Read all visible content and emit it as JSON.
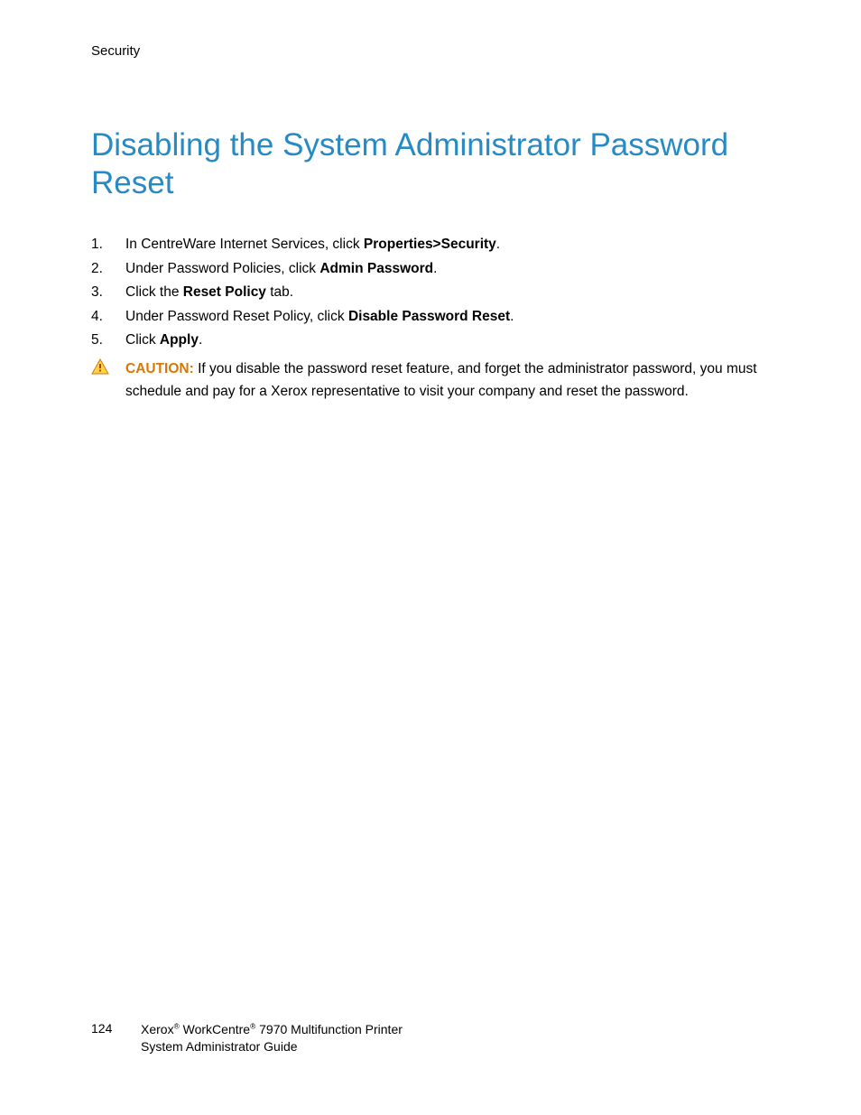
{
  "header": "Security",
  "title": "Disabling the System Administrator Password Reset",
  "steps": [
    {
      "num": "1.",
      "pre": "In CentreWare Internet Services, click ",
      "bold": "Properties>Security",
      "post": "."
    },
    {
      "num": "2.",
      "pre": "Under Password Policies, click ",
      "bold": "Admin Password",
      "post": "."
    },
    {
      "num": "3.",
      "pre": "Click the ",
      "bold": "Reset Policy",
      "post": " tab."
    },
    {
      "num": "4.",
      "pre": "Under Password Reset Policy, click ",
      "bold": "Disable Password Reset",
      "post": "."
    },
    {
      "num": "5.",
      "pre": "Click ",
      "bold": "Apply",
      "post": "."
    }
  ],
  "caution": {
    "label": "CAUTION:",
    "text": " If you disable the password reset feature, and forget the administrator password, you must schedule and pay for a Xerox representative to visit your company and reset the password."
  },
  "footer": {
    "page": "124",
    "line1_a": "Xerox",
    "line1_b": " WorkCentre",
    "line1_c": " 7970 Multifunction Printer",
    "line2": "System Administrator Guide",
    "reg": "®"
  }
}
